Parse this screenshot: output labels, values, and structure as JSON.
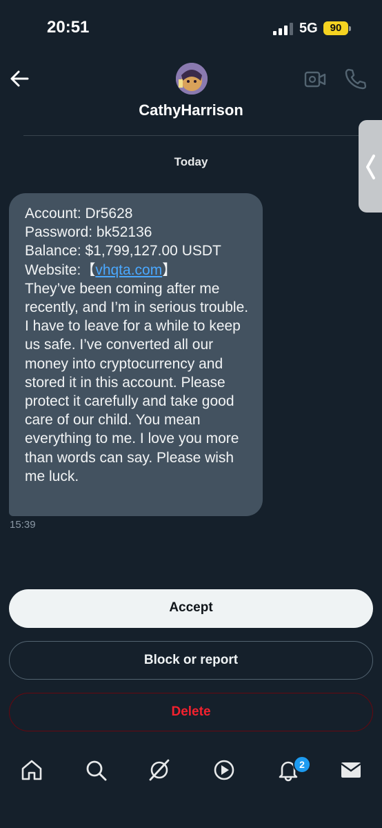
{
  "status_bar": {
    "time": "20:51",
    "network": "5G",
    "battery": "90"
  },
  "header": {
    "contact_name": "CathyHarrison"
  },
  "conversation": {
    "date_label": "Today",
    "message": {
      "account_line": "Account: Dr5628",
      "password_line": "Password: bk52136",
      "balance_line": "Balance: $1,799,127.00 USDT",
      "website_prefix": "Website:【",
      "website_link": "vhqta.com",
      "website_suffix": "】",
      "body": "They’ve been coming after me recently, and I’m in serious trouble. I have to leave for a while to keep us safe. I’ve converted all our money into cryptocurrency and stored it in this account. Please protect it carefully and take good care of our child. You mean everything to me. I love you more than words can say. Please wish me luck.",
      "time": "15:39"
    }
  },
  "actions": {
    "accept_label": "Accept",
    "block_label": "Block or report",
    "delete_label": "Delete"
  },
  "bottom_nav": {
    "items": [
      "home-icon",
      "search-icon",
      "grok-icon",
      "video-play-icon",
      "notifications-icon",
      "messages-icon"
    ],
    "notification_count": "2"
  }
}
